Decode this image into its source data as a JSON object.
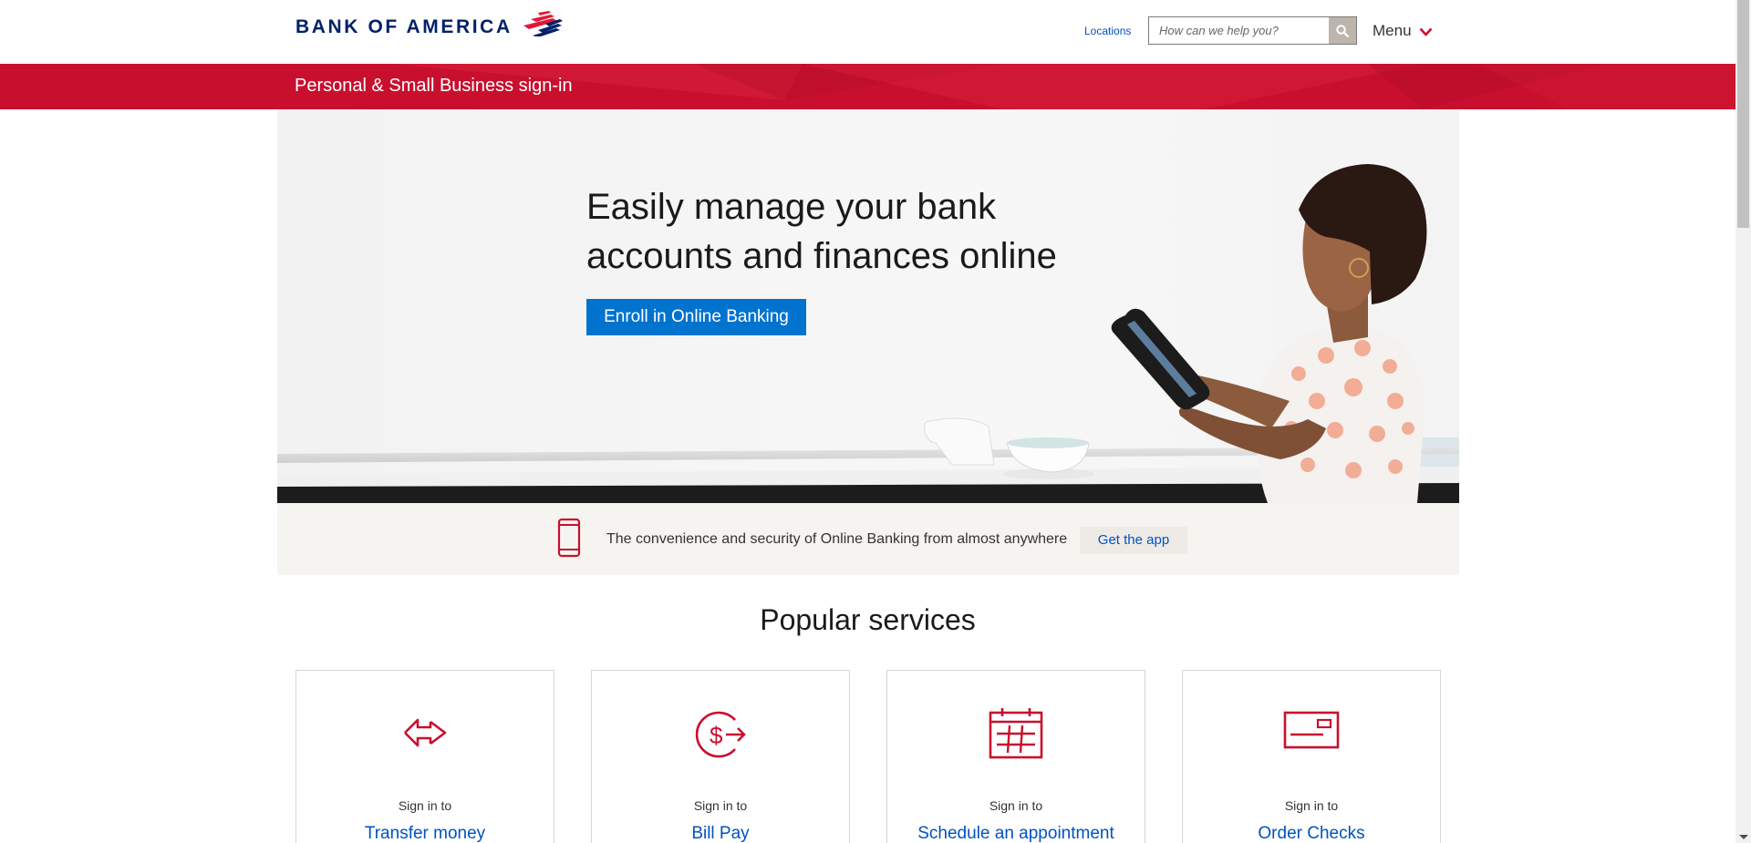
{
  "header": {
    "logo_text": "BANK OF AMERICA",
    "locations_label": "Locations",
    "search_placeholder": "How can we help you?",
    "menu_label": "Menu"
  },
  "banner": {
    "title": "Personal & Small Business sign-in"
  },
  "hero": {
    "headline": "Easily manage your bank accounts and finances online",
    "enroll_label": "Enroll in Online Banking"
  },
  "app_strip": {
    "text": "The convenience and security of Online Banking from almost anywhere",
    "get_app_label": "Get the app"
  },
  "services": {
    "title": "Popular services",
    "cards": [
      {
        "sub": "Sign in to",
        "link": "Transfer money",
        "icon": "transfer-icon"
      },
      {
        "sub": "Sign in to",
        "link": "Bill Pay",
        "icon": "bill-pay-icon"
      },
      {
        "sub": "Sign in to",
        "link": "Schedule an appointment",
        "icon": "calendar-icon"
      },
      {
        "sub": "Sign in to",
        "link": "Order Checks",
        "icon": "check-icon"
      }
    ]
  },
  "colors": {
    "brand_red": "#c8102e",
    "brand_navy": "#012169",
    "link_blue": "#0052c2",
    "button_blue": "#0073cf"
  }
}
